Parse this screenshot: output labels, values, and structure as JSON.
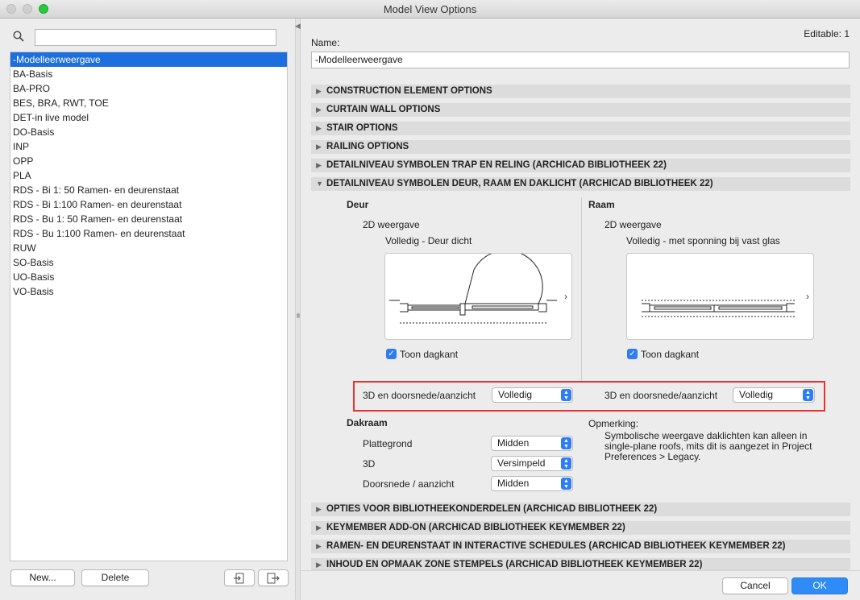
{
  "window": {
    "title": "Model View Options"
  },
  "left": {
    "search": {
      "placeholder": ""
    },
    "items": [
      {
        "label": "-Modelleerweergave",
        "selected": true
      },
      {
        "label": "BA-Basis"
      },
      {
        "label": "BA-PRO"
      },
      {
        "label": "BES, BRA, RWT, TOE"
      },
      {
        "label": "DET-in live model"
      },
      {
        "label": "DO-Basis"
      },
      {
        "label": "INP"
      },
      {
        "label": "OPP"
      },
      {
        "label": "PLA"
      },
      {
        "label": "RDS - Bi 1: 50 Ramen- en deurenstaat"
      },
      {
        "label": "RDS - Bi 1:100 Ramen- en deurenstaat"
      },
      {
        "label": "RDS - Bu 1: 50 Ramen- en deurenstaat"
      },
      {
        "label": "RDS - Bu 1:100 Ramen- en deurenstaat"
      },
      {
        "label": "RUW"
      },
      {
        "label": "SO-Basis"
      },
      {
        "label": "UO-Basis"
      },
      {
        "label": "VO-Basis"
      }
    ],
    "new_label": "New...",
    "delete_label": "Delete"
  },
  "right": {
    "editable": "Editable: 1",
    "name_label": "Name:",
    "name_value": "-Modelleerweergave",
    "sections_top": [
      "CONSTRUCTION ELEMENT OPTIONS",
      "CURTAIN WALL OPTIONS",
      "STAIR OPTIONS",
      "RAILING OPTIONS",
      "DETAILNIVEAU SYMBOLEN TRAP EN RELING (ARCHICAD BIBLIOTHEEK 22)"
    ],
    "expanded_section": "DETAILNIVEAU SYMBOLEN DEUR, RAAM EN DAKLICHT (ARCHICAD BIBLIOTHEEK 22)",
    "deur": {
      "heading": "Deur",
      "view_label": "2D weergave",
      "view_value": "Volledig - Deur dicht",
      "checkbox_label": "Toon dagkant",
      "sub_label": "3D en doorsnede/aanzicht",
      "sub_value": "Volledig"
    },
    "raam": {
      "heading": "Raam",
      "view_label": "2D weergave",
      "view_value": "Volledig - met sponning bij vast glas",
      "checkbox_label": "Toon dagkant",
      "sub_label": "3D en doorsnede/aanzicht",
      "sub_value": "Volledig"
    },
    "dakraam": {
      "heading": "Dakraam",
      "rows": [
        {
          "label": "Plattegrond",
          "value": "Midden"
        },
        {
          "label": "3D",
          "value": "Versimpeld"
        },
        {
          "label": "Doorsnede / aanzicht",
          "value": "Midden"
        }
      ]
    },
    "remark": {
      "heading": "Opmerking:",
      "lines": [
        "Symbolische weergave daklichten kan alleen in",
        "single-plane roofs, mits dit is aangezet in Project",
        "Preferences > Legacy."
      ]
    },
    "sections_bottom": [
      "OPTIES VOOR BIBLIOTHEEKONDERDELEN (ARCHICAD BIBLIOTHEEK 22)",
      "KEYMEMBER ADD-ON (ARCHICAD BIBLIOTHEEK KEYMEMBER 22)",
      "RAMEN- EN DEURENSTAAT IN INTERACTIVE SCHEDULES (ARCHICAD BIBLIOTHEEK KEYMEMBER 22)",
      "INHOUD EN OPMAAK ZONE STEMPELS (ARCHICAD BIBLIOTHEEK KEYMEMBER 22)"
    ],
    "cancel_label": "Cancel",
    "ok_label": "OK"
  },
  "colors": {
    "accent": "#1c6fdc",
    "ok": "#2f8cf6",
    "highlight": "#e8322e"
  }
}
